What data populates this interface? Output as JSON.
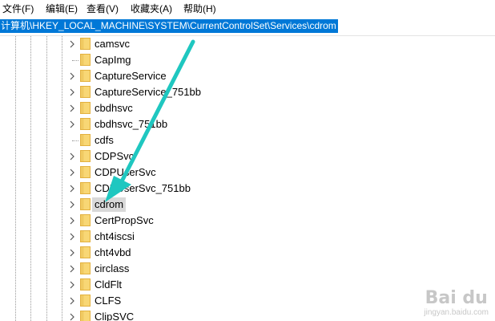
{
  "menubar": {
    "items": [
      {
        "label": "文件(F)"
      },
      {
        "label": "编辑(E)"
      },
      {
        "label": "查看(V)"
      },
      {
        "label": "收藏夹(A)"
      },
      {
        "label": "帮助(H)"
      }
    ]
  },
  "address": {
    "path": "计算机\\HKEY_LOCAL_MACHINE\\SYSTEM\\CurrentControlSet\\Services\\cdrom"
  },
  "tree": {
    "items": [
      {
        "label": "camsvc",
        "expandable": true,
        "selected": false
      },
      {
        "label": "CapImg",
        "expandable": false,
        "selected": false
      },
      {
        "label": "CaptureService",
        "expandable": true,
        "selected": false
      },
      {
        "label": "CaptureService_751bb",
        "expandable": true,
        "selected": false
      },
      {
        "label": "cbdhsvc",
        "expandable": true,
        "selected": false
      },
      {
        "label": "cbdhsvc_751bb",
        "expandable": true,
        "selected": false
      },
      {
        "label": "cdfs",
        "expandable": false,
        "selected": false
      },
      {
        "label": "CDPSvc",
        "expandable": true,
        "selected": false
      },
      {
        "label": "CDPUserSvc",
        "expandable": true,
        "selected": false
      },
      {
        "label": "CDPUserSvc_751bb",
        "expandable": true,
        "selected": false
      },
      {
        "label": "cdrom",
        "expandable": true,
        "selected": true
      },
      {
        "label": "CertPropSvc",
        "expandable": true,
        "selected": false
      },
      {
        "label": "cht4iscsi",
        "expandable": true,
        "selected": false
      },
      {
        "label": "cht4vbd",
        "expandable": true,
        "selected": false
      },
      {
        "label": "circlass",
        "expandable": true,
        "selected": false
      },
      {
        "label": "CldFlt",
        "expandable": true,
        "selected": false
      },
      {
        "label": "CLFS",
        "expandable": true,
        "selected": false
      },
      {
        "label": "ClipSVC",
        "expandable": true,
        "selected": false
      }
    ]
  },
  "annotation": {
    "arrow_color": "#1fc7c0"
  },
  "watermark": {
    "logo": "Bai  du",
    "paw": "🐾",
    "sub": "jingyan.baidu.com"
  },
  "colors": {
    "selection": "#0078d7",
    "selected_row": "#d9d9d9",
    "folder": "#f8d775",
    "folder_dark": "#e3b13f"
  }
}
